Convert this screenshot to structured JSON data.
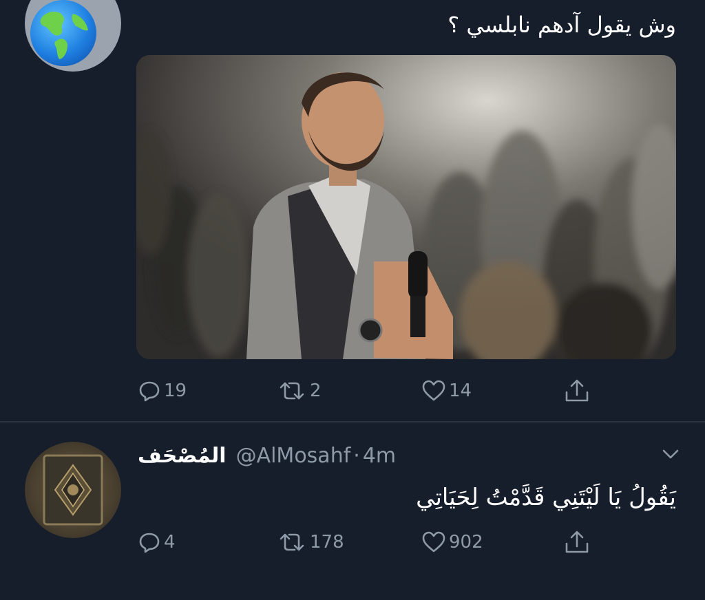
{
  "tweet1": {
    "text": "وش يقول آدهم نابلسي ؟",
    "avatar_icon": "globe-icon",
    "reply_count": "19",
    "retweet_count": "2",
    "like_count": "14"
  },
  "tweet2": {
    "display_name": "المُصْحَف",
    "handle": "@AlMosahf",
    "separator": "·",
    "time": "4m",
    "text": "يَقُولُ يَا لَيْتَنِي قَدَّمْتُ لِحَيَاتِي",
    "reply_count": "4",
    "retweet_count": "178",
    "like_count": "902"
  },
  "colors": {
    "background": "#161d2b",
    "text": "#ffffff",
    "muted": "#8f9aa8",
    "divider": "#2a3444"
  }
}
